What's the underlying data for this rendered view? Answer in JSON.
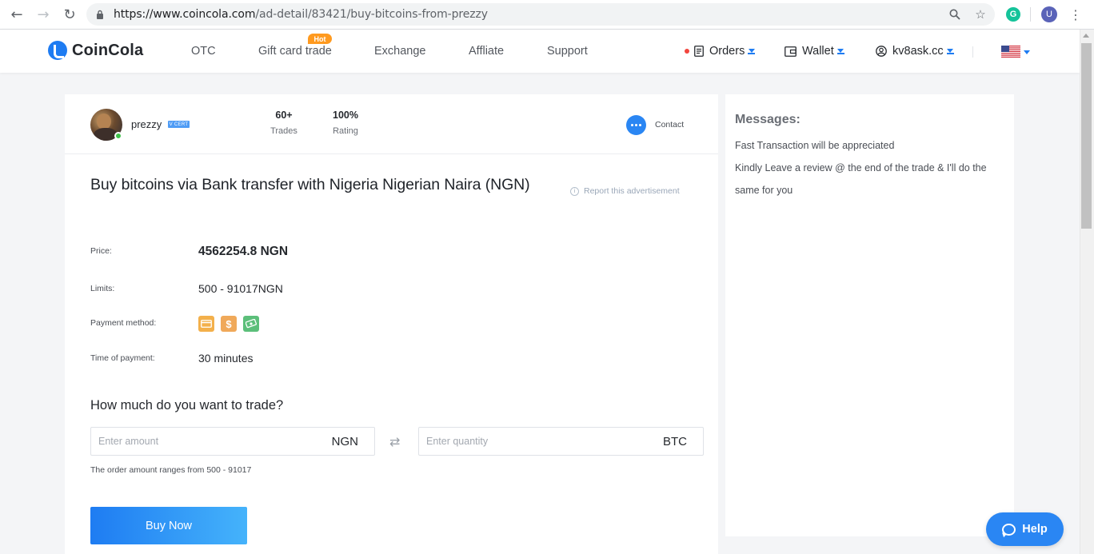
{
  "browser": {
    "url_host": "https://www.coincola.com",
    "url_path": "/ad-detail/83421/buy-bitcoins-from-prezzy",
    "extension_letter": "G",
    "profile_letter": "U"
  },
  "header": {
    "logo_text": "CoinCola",
    "menu": [
      {
        "label": "OTC"
      },
      {
        "label": "Gift card trade"
      },
      {
        "label": "Exchange"
      },
      {
        "label": "Affliate"
      },
      {
        "label": "Support"
      }
    ],
    "hot_badge": "Hot",
    "orders_label": "Orders",
    "wallet_label": "Wallet",
    "user_label": "kv8ask.cc"
  },
  "merchant": {
    "name": "prezzy",
    "cert_label": "V CERT",
    "trades_value": "60+",
    "trades_label": "Trades",
    "rating_value": "100%",
    "rating_label": "Rating",
    "contact_label": "Contact"
  },
  "ad": {
    "title": "Buy bitcoins via Bank transfer with Nigeria Nigerian Naira (NGN)",
    "report_label": "Report this advertisement",
    "price_label": "Price:",
    "price_value": "4562254.8 NGN",
    "limits_label": "Limits:",
    "limits_value": "500 - 91017NGN",
    "payment_label": "Payment method:",
    "payment_icons": [
      "card-icon",
      "dollar-icon",
      "cash-icon"
    ],
    "payment_colors": [
      "#f3b04b",
      "#f0a95a",
      "#5cbf7a"
    ],
    "time_label": "Time of payment:",
    "time_value": "30 minutes"
  },
  "trade": {
    "question": "How much do you want to trade?",
    "amount_placeholder": "Enter amount",
    "amount_unit": "NGN",
    "quantity_placeholder": "Enter quantity",
    "quantity_unit": "BTC",
    "range_note": "The order amount ranges from 500 - 91017",
    "buy_label": "Buy Now"
  },
  "messages": {
    "title": "Messages:",
    "lines": [
      "Fast Transaction will be appreciated",
      "Kindly Leave a review @ the end of the trade & I'll do the",
      "same for you"
    ]
  },
  "help": {
    "label": "Help"
  },
  "colors": {
    "accent": "#1e7cf2",
    "hot": "#ff9a1f",
    "online": "#3fc24a",
    "notification": "#f2453d"
  }
}
